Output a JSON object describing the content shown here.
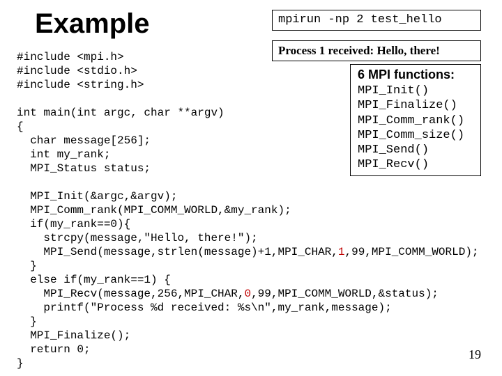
{
  "title": "Example",
  "command": "mpirun -np 2 test_hello",
  "output": "Process 1 received: Hello, there!",
  "funcs": {
    "title": "6 MPI functions:",
    "items": [
      "MPI_Init()",
      "MPI_Finalize()",
      "MPI_Comm_rank()",
      "MPI_Comm_size()",
      "MPI_Send()",
      "MPI_Recv()"
    ]
  },
  "code": {
    "l01": "#include <mpi.h>",
    "l02": "#include <stdio.h>",
    "l03": "#include <string.h>",
    "l04": "",
    "l05": "int main(int argc, char **argv)",
    "l06": "{",
    "l07": "  char message[256];",
    "l08": "  int my_rank;",
    "l09": "  MPI_Status status;",
    "l10": "",
    "l11": "  MPI_Init(&argc,&argv);",
    "l12": "  MPI_Comm_rank(MPI_COMM_WORLD,&my_rank);",
    "l13": "  if(my_rank==0){",
    "l14": "    strcpy(message,\"Hello, there!\");",
    "l15a": "    MPI_Send(message,strlen(message)+1,MPI_CHAR,",
    "l15b": "1",
    "l15c": ",99,MPI_COMM_WORLD);",
    "l16": "  }",
    "l17": "  else if(my_rank==1) {",
    "l18a": "    MPI_Recv(message,256,MPI_CHAR,",
    "l18b": "0",
    "l18c": ",99,MPI_COMM_WORLD,&status);",
    "l19": "    printf(\"Process %d received: %s\\n\",my_rank,message);",
    "l20": "  }",
    "l21": "  MPI_Finalize();",
    "l22": "  return 0;",
    "l23": "}"
  },
  "pagenum": "19"
}
